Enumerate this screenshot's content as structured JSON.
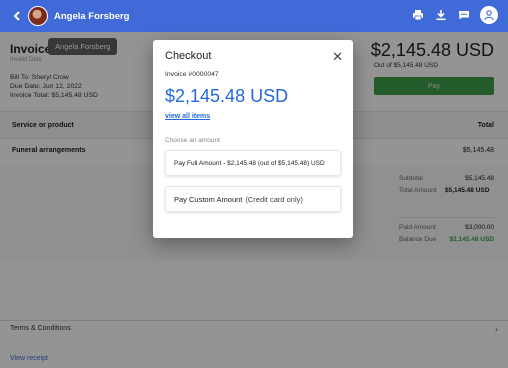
{
  "header": {
    "user_name": "Angela Forsberg",
    "icons": [
      "back-arrow-icon",
      "avatar",
      "print-icon",
      "download-icon",
      "chat-icon",
      "account-icon"
    ]
  },
  "invoice_bg": {
    "title": "Invoice",
    "tooltip": "Angela Forsberg",
    "subtitle": "Invalid Date",
    "bill_to": "Bill To: Sheryl Crow",
    "due_date": "Due Date: Jun 12, 2022",
    "invoice_total": "Invoice Total: $5,145.48 USD",
    "big_total": "$2,145.48 USD",
    "out_of": "Out of $5,145.48 USD",
    "pay_label": "Pay",
    "col_service": "Service or product",
    "col_total": "Total",
    "item_name": "Funeral arrangements",
    "item_amount": "$5,145.48",
    "subtotal_label": "Subtotal",
    "subtotal_value": "$5,145.48",
    "total_amount_label": "Total Amount",
    "total_amount_value": "$5,145.48 USD",
    "paid_label": "Paid Amount",
    "paid_value": "$3,000.00",
    "balance_label": "Balance Due",
    "balance_value": "$2,145.48 USD",
    "terms": "Terms & Conditions",
    "view_receipt": "View receipt"
  },
  "modal": {
    "title": "Checkout",
    "invoice_number": "Invoice #0000047",
    "amount": "$2,145.48 USD",
    "view_all": "view all items",
    "choose_label": "Choose an amount",
    "option_full": "Pay Full Amount - $2,145.48 (out of $5,145.48) USD",
    "option_custom": "Pay Custom Amount",
    "option_custom_note": "(Credit card only)"
  },
  "colors": {
    "topbar": "#3f6ad8",
    "accent_blue": "#2468d8",
    "pay_green": "#3f9e49"
  }
}
